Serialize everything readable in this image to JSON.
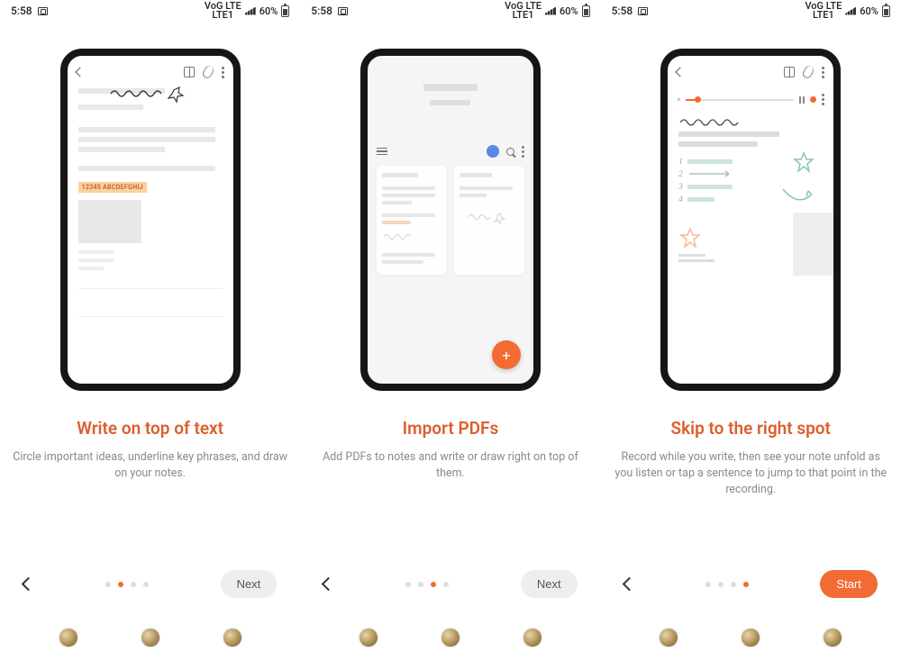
{
  "status": {
    "time": "5:58",
    "battery": "60%",
    "network_label": "VoLTE"
  },
  "panes": [
    {
      "title": "Write on top of text",
      "desc": "Circle important ideas, underline key phrases, and draw on your notes.",
      "highlight_text": "12345 ABCDEFGHIJ",
      "dots_active": 1,
      "button": "Next",
      "button_primary": false
    },
    {
      "title": "Import PDFs",
      "desc": "Add PDFs to notes and write or draw right on top of them.",
      "dots_active": 2,
      "button": "Next",
      "button_primary": false,
      "fab": "+"
    },
    {
      "title": "Skip to the right spot",
      "desc": "Record while you write, then see your note unfold as you listen or tap a sentence to jump to that point in the recording.",
      "dots_active": 3,
      "button": "Start",
      "button_primary": true,
      "list_numbers": [
        "1",
        "2",
        "3",
        "4"
      ],
      "player_start": ">"
    }
  ]
}
